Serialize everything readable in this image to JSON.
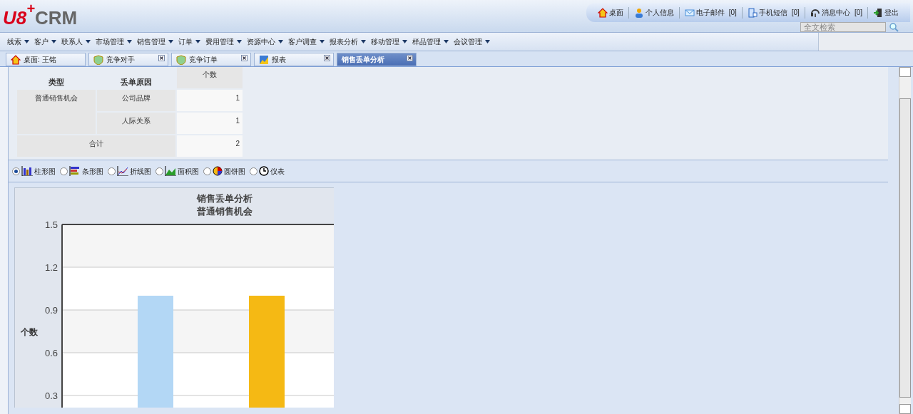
{
  "logo": {
    "main": "U8",
    "sup": "+",
    "tail": "CRM"
  },
  "top_links": [
    {
      "kind": "home",
      "label": "桌面"
    },
    {
      "kind": "person",
      "label": "个人信息"
    },
    {
      "kind": "mail",
      "label": "电子邮件",
      "count": "[0]"
    },
    {
      "kind": "phone",
      "label": "手机短信",
      "count": "[0]"
    },
    {
      "kind": "message",
      "label": "消息中心",
      "count": "[0]"
    },
    {
      "kind": "exit",
      "label": "登出"
    }
  ],
  "search": {
    "placeholder": "全文检索"
  },
  "menu": [
    "线索",
    "客户",
    "联系人",
    "市场管理",
    "销售管理",
    "订单",
    "费用管理",
    "资源中心",
    "客户调查",
    "报表分析",
    "移动管理",
    "样品管理",
    "会议管理"
  ],
  "tabs": [
    {
      "kind": "home",
      "label": "桌面: 王铭",
      "closable": false,
      "selected": false
    },
    {
      "kind": "badge",
      "label": "竞争对手",
      "closable": true,
      "selected": false
    },
    {
      "kind": "badge",
      "label": "竞争订单",
      "closable": true,
      "selected": false
    },
    {
      "kind": "report",
      "label": "报表",
      "closable": true,
      "selected": false
    },
    {
      "kind": "none",
      "label": "销售丢单分析",
      "closable": true,
      "selected": true
    }
  ],
  "table": {
    "columns": [
      "类型",
      "丢单原因",
      "个数"
    ],
    "groups": [
      {
        "type": "普通销售机会",
        "rows": [
          {
            "reason": "公司品牌",
            "count": "1"
          },
          {
            "reason": "人际关系",
            "count": "1"
          }
        ]
      }
    ],
    "total": {
      "label": "合计",
      "count": "2"
    }
  },
  "chart_types": [
    {
      "kind": "column",
      "label": "柱形图",
      "selected": true
    },
    {
      "kind": "bar",
      "label": "条形图",
      "selected": false
    },
    {
      "kind": "line",
      "label": "折线图",
      "selected": false
    },
    {
      "kind": "area",
      "label": "面积图",
      "selected": false
    },
    {
      "kind": "pie",
      "label": "圆饼图",
      "selected": false
    },
    {
      "kind": "gauge",
      "label": "仪表",
      "selected": false
    }
  ],
  "chart": {
    "subtitle": "普通销售机会",
    "chart_data": {
      "type": "bar",
      "title": "销售丢单分析",
      "ylabel": "个数",
      "values": [
        1,
        1
      ],
      "colors": [
        "#b3d7f5",
        "#f5b914"
      ],
      "grid": true,
      "ylim": [
        0.2,
        1.5
      ],
      "yticks": [
        0.3,
        0.6,
        0.9,
        1.2,
        1.5
      ]
    }
  }
}
